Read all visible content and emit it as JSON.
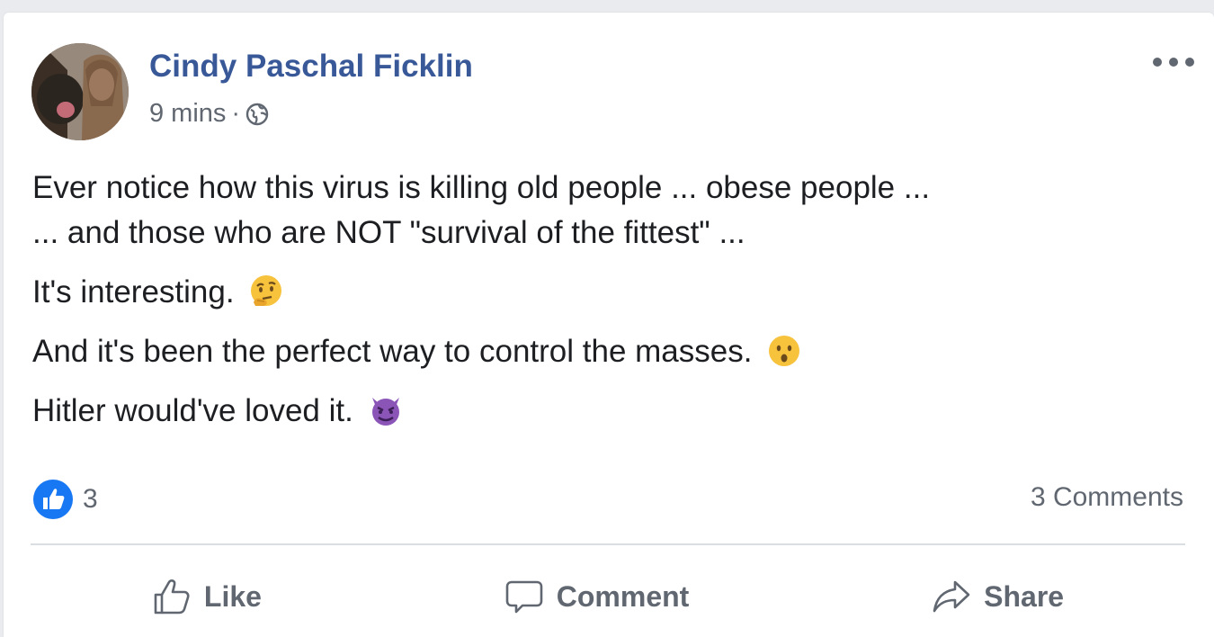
{
  "post": {
    "author": "Cindy Paschal Ficklin",
    "time": "9 mins",
    "separator": "·",
    "privacy_icon": "globe-icon",
    "lines": [
      "Ever notice how this virus is killing old people ... obese people ...",
      "... and those who are NOT \"survival of the fittest\" ...",
      "It's interesting.",
      "And it's been the perfect way to control the masses.",
      "Hitler would've loved it."
    ],
    "emojis": [
      "thinking-face-emoji",
      "hushed-face-emoji",
      "smiling-imp-emoji"
    ]
  },
  "reactions": {
    "icon": "like-reaction-icon",
    "count": "3",
    "comments": "3 Comments"
  },
  "actions": {
    "like": "Like",
    "comment": "Comment",
    "share": "Share"
  },
  "colors": {
    "author": "#385898",
    "text": "#1c1e21",
    "muted": "#606770",
    "like_blue": "#1877f2",
    "background": "#e9ebee"
  }
}
